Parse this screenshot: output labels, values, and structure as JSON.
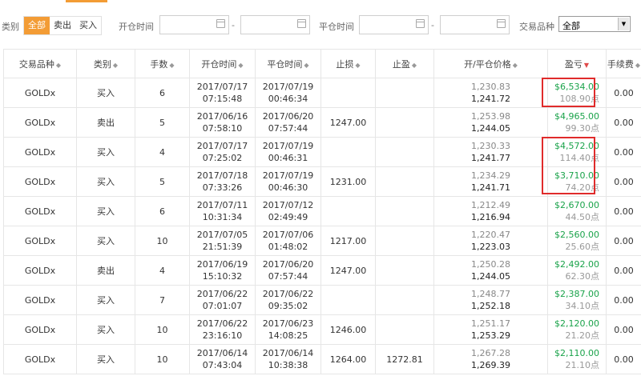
{
  "filters": {
    "type_label": "类别",
    "type_options": [
      "全部",
      "卖出",
      "买入"
    ],
    "open_time_label": "开仓时间",
    "close_time_label": "平仓时间",
    "product_label": "交易品种",
    "product_selected": "全部",
    "range_dash": "-"
  },
  "table": {
    "headers": [
      "交易品种",
      "类别",
      "手数",
      "开仓时间",
      "平仓时间",
      "止损",
      "止盈",
      "开/平仓价格",
      "盈亏",
      "手续费"
    ],
    "rows": [
      {
        "symbol": "GOLDx",
        "type": "买入",
        "lots": "6",
        "open_date": "2017/07/17",
        "open_time": "07:15:48",
        "close_date": "2017/07/19",
        "close_time": "00:46:34",
        "sl": "",
        "tp": "",
        "open_price": "1,230.83",
        "close_price": "1,241.72",
        "pnl": "$6,534.00",
        "points": "108.90点",
        "fee": "0.00"
      },
      {
        "symbol": "GOLDx",
        "type": "卖出",
        "lots": "5",
        "open_date": "2017/06/16",
        "open_time": "07:58:10",
        "close_date": "2017/06/20",
        "close_time": "07:57:44",
        "sl": "1247.00",
        "tp": "",
        "open_price": "1,253.98",
        "close_price": "1,244.05",
        "pnl": "$4,965.00",
        "points": "99.30点",
        "fee": "0.00"
      },
      {
        "symbol": "GOLDx",
        "type": "买入",
        "lots": "4",
        "open_date": "2017/07/17",
        "open_time": "07:25:02",
        "close_date": "2017/07/19",
        "close_time": "00:46:31",
        "sl": "",
        "tp": "",
        "open_price": "1,230.33",
        "close_price": "1,241.77",
        "pnl": "$4,572.00",
        "points": "114.40点",
        "fee": "0.00"
      },
      {
        "symbol": "GOLDx",
        "type": "买入",
        "lots": "5",
        "open_date": "2017/07/18",
        "open_time": "07:33:26",
        "close_date": "2017/07/19",
        "close_time": "00:46:30",
        "sl": "1231.00",
        "tp": "",
        "open_price": "1,234.29",
        "close_price": "1,241.71",
        "pnl": "$3,710.00",
        "points": "74.20点",
        "fee": "0.00"
      },
      {
        "symbol": "GOLDx",
        "type": "买入",
        "lots": "6",
        "open_date": "2017/07/11",
        "open_time": "10:31:34",
        "close_date": "2017/07/12",
        "close_time": "02:49:49",
        "sl": "",
        "tp": "",
        "open_price": "1,212.49",
        "close_price": "1,216.94",
        "pnl": "$2,670.00",
        "points": "44.50点",
        "fee": "0.00"
      },
      {
        "symbol": "GOLDx",
        "type": "买入",
        "lots": "10",
        "open_date": "2017/07/05",
        "open_time": "21:51:39",
        "close_date": "2017/07/06",
        "close_time": "01:48:02",
        "sl": "1217.00",
        "tp": "",
        "open_price": "1,220.47",
        "close_price": "1,223.03",
        "pnl": "$2,560.00",
        "points": "25.60点",
        "fee": "0.00"
      },
      {
        "symbol": "GOLDx",
        "type": "卖出",
        "lots": "4",
        "open_date": "2017/06/19",
        "open_time": "15:10:32",
        "close_date": "2017/06/20",
        "close_time": "07:57:44",
        "sl": "1247.00",
        "tp": "",
        "open_price": "1,250.28",
        "close_price": "1,244.05",
        "pnl": "$2,492.00",
        "points": "62.30点",
        "fee": "0.00"
      },
      {
        "symbol": "GOLDx",
        "type": "买入",
        "lots": "7",
        "open_date": "2017/06/22",
        "open_time": "07:01:07",
        "close_date": "2017/06/22",
        "close_time": "09:35:02",
        "sl": "",
        "tp": "",
        "open_price": "1,248.77",
        "close_price": "1,252.18",
        "pnl": "$2,387.00",
        "points": "34.10点",
        "fee": "0.00"
      },
      {
        "symbol": "GOLDx",
        "type": "买入",
        "lots": "10",
        "open_date": "2017/06/22",
        "open_time": "23:16:10",
        "close_date": "2017/06/23",
        "close_time": "14:08:25",
        "sl": "1246.00",
        "tp": "",
        "open_price": "1,251.17",
        "close_price": "1,253.29",
        "pnl": "$2,120.00",
        "points": "21.20点",
        "fee": "0.00"
      },
      {
        "symbol": "GOLDx",
        "type": "买入",
        "lots": "10",
        "open_date": "2017/06/14",
        "open_time": "07:43:04",
        "close_date": "2017/06/14",
        "close_time": "10:38:38",
        "sl": "1264.00",
        "tp": "1272.81",
        "open_price": "1,267.28",
        "close_price": "1,269.39",
        "pnl": "$2,110.00",
        "points": "21.10点",
        "fee": "0.00"
      }
    ]
  },
  "colors": {
    "accent": "#f39c35",
    "buy": "#1aa34a",
    "sell": "#e04a4a",
    "profit": "#1aa34a",
    "highlight": "#e02b2b"
  }
}
